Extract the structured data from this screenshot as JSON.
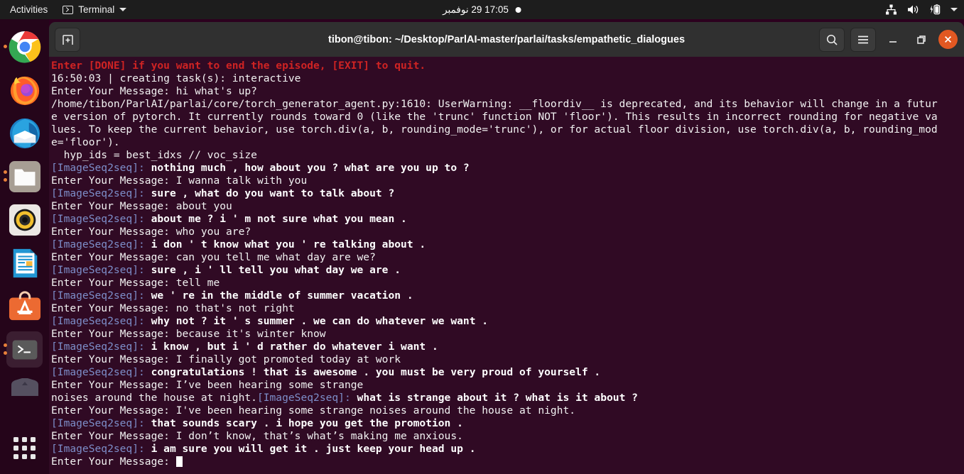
{
  "topbar": {
    "activities": "Activities",
    "app_menu": "Terminal",
    "app_icon": "terminal-icon",
    "menu_arrow_icon": "chevron-down-icon",
    "clock": "17:05  29 نوفمبر",
    "recording_indicator_icon": "record-dot-icon",
    "tray_icons": [
      "network-icon",
      "volume-icon",
      "battery-charging-icon",
      "chevron-down-icon"
    ]
  },
  "dock": {
    "items": [
      {
        "name": "google-chrome",
        "icon": "chrome-icon",
        "running": true
      },
      {
        "name": "firefox",
        "icon": "firefox-icon",
        "running": false
      },
      {
        "name": "thunderbird",
        "icon": "thunderbird-icon",
        "running": false
      },
      {
        "name": "files",
        "icon": "files-icon",
        "running": true
      },
      {
        "name": "rhythmbox",
        "icon": "rhythmbox-icon",
        "running": false
      },
      {
        "name": "libreoffice-writer",
        "icon": "libreoffice-writer-icon",
        "running": false
      },
      {
        "name": "ubuntu-software",
        "icon": "ubuntu-software-icon",
        "running": false
      },
      {
        "name": "terminal",
        "icon": "terminal-icon",
        "running": true,
        "active": true
      },
      {
        "name": "trash",
        "icon": "trash-icon",
        "running": false
      }
    ],
    "show_apps": "show-applications-icon"
  },
  "window": {
    "title": "tibon@tibon: ~/Desktop/ParlAI-master/parlai/tasks/empathetic_dialogues",
    "new_tab_icon": "new-tab-icon",
    "search_icon": "search-icon",
    "menu_icon": "hamburger-menu-icon",
    "minimize_icon": "minimize-icon",
    "maximize_icon": "maximize-icon",
    "close_icon": "close-icon"
  },
  "terminal": {
    "prompt": "Enter Your Message: ",
    "agent_label": "[ImageSeq2seq]: ",
    "lines": [
      {
        "type": "red",
        "text": "Enter [DONE] if you want to end the episode, [EXIT] to quit."
      },
      {
        "type": "plain",
        "text": "16:50:03 | creating task(s): interactive"
      },
      {
        "type": "plain",
        "text": "Enter Your Message: hi what's up?"
      },
      {
        "type": "plain",
        "text": "/home/tibon/ParlAI/parlai/core/torch_generator_agent.py:1610: UserWarning: __floordiv__ is deprecated, and its behavior will change in a futur"
      },
      {
        "type": "plain",
        "text": "e version of pytorch. It currently rounds toward 0 (like the 'trunc' function NOT 'floor'). This results in incorrect rounding for negative va"
      },
      {
        "type": "plain",
        "text": "lues. To keep the current behavior, use torch.div(a, b, rounding_mode='trunc'), or for actual floor division, use torch.div(a, b, rounding_mod"
      },
      {
        "type": "plain",
        "text": "e='floor')."
      },
      {
        "type": "plain",
        "text": "  hyp_ids = best_idxs // voc_size"
      },
      {
        "type": "agent",
        "label": "[ImageSeq2seq]: ",
        "text": "nothing much , how about you ? what are you up to ?"
      },
      {
        "type": "plain",
        "text": "Enter Your Message: I wanna talk with you"
      },
      {
        "type": "agent",
        "label": "[ImageSeq2seq]: ",
        "text": "sure , what do you want to talk about ?"
      },
      {
        "type": "plain",
        "text": "Enter Your Message: about you"
      },
      {
        "type": "agent",
        "label": "[ImageSeq2seq]: ",
        "text": "about me ? i ' m not sure what you mean ."
      },
      {
        "type": "plain",
        "text": "Enter Your Message: who you are?"
      },
      {
        "type": "agent",
        "label": "[ImageSeq2seq]: ",
        "text": "i don ' t know what you ' re talking about ."
      },
      {
        "type": "plain",
        "text": "Enter Your Message: can you tell me what day are we?"
      },
      {
        "type": "agent",
        "label": "[ImageSeq2seq]: ",
        "text": "sure , i ' ll tell you what day we are ."
      },
      {
        "type": "plain",
        "text": "Enter Your Message: tell me"
      },
      {
        "type": "agent",
        "label": "[ImageSeq2seq]: ",
        "text": "we ' re in the middle of summer vacation ."
      },
      {
        "type": "plain",
        "text": "Enter Your Message: no that's not right"
      },
      {
        "type": "agent",
        "label": "[ImageSeq2seq]: ",
        "text": "why not ? it ' s summer . we can do whatever we want ."
      },
      {
        "type": "plain",
        "text": "Enter Your Message: because it's winter know"
      },
      {
        "type": "agent",
        "label": "[ImageSeq2seq]: ",
        "text": "i know , but i ' d rather do whatever i want ."
      },
      {
        "type": "plain",
        "text": "Enter Your Message: I finally got promoted today at work"
      },
      {
        "type": "agent",
        "label": "[ImageSeq2seq]: ",
        "text": "congratulations ! that is awesome . you must be very proud of yourself ."
      },
      {
        "type": "plain",
        "text": "Enter Your Message: I’ve been hearing some strange"
      },
      {
        "type": "mixed",
        "pre": "noises around the house at night.",
        "label": "[ImageSeq2seq]: ",
        "text": "what is strange about it ? what is it about ?"
      },
      {
        "type": "plain",
        "text": "Enter Your Message: I've been hearing some strange noises around the house at night."
      },
      {
        "type": "agent",
        "label": "[ImageSeq2seq]: ",
        "text": "that sounds scary . i hope you get the promotion ."
      },
      {
        "type": "plain",
        "text": "Enter Your Message: I don’t know, that’s what’s making me anxious."
      },
      {
        "type": "agent",
        "label": "[ImageSeq2seq]: ",
        "text": "i am sure you will get it . just keep your head up ."
      },
      {
        "type": "cursor",
        "text": "Enter Your Message: "
      }
    ]
  },
  "colors": {
    "terminal_bg": "#300a24",
    "error_red": "#cf2323",
    "agent_blue": "#7d8ec9",
    "titlebar": "#303030",
    "close_button": "#e25822",
    "topbar": "#1d1d1d"
  }
}
